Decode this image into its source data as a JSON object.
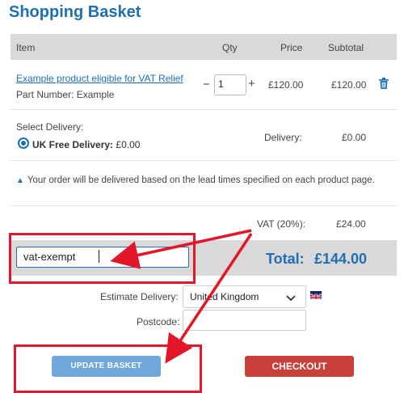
{
  "page": {
    "title": "Shopping Basket"
  },
  "table": {
    "headers": {
      "item": "Item",
      "qty": "Qty",
      "price": "Price",
      "subtotal": "Subtotal"
    }
  },
  "product": {
    "name": "Example product eligible for VAT Relief",
    "part_number": "Part Number: Example",
    "qty_minus": "−",
    "qty": "1",
    "qty_plus": "+",
    "price": "£120.00",
    "subtotal": "£120.00",
    "remove_icon": "trash-icon"
  },
  "delivery": {
    "select_label": "Select Delivery:",
    "option_label": "UK Free Delivery:",
    "option_price": "£0.00",
    "summary_label": "Delivery:",
    "summary_value": "£0.00"
  },
  "notice": {
    "icon": "triangle-up-icon",
    "text": "Your order will be delivered based on the lead times specified on each product page."
  },
  "vat": {
    "label": "VAT (20%):",
    "value": "£24.00"
  },
  "vat_input": {
    "value": "vat-exempt"
  },
  "total": {
    "label": "Total:",
    "value": "£144.00"
  },
  "estimate": {
    "label": "Estimate Delivery:",
    "country": "United Kingdom",
    "flag_icon": "uk-flag-icon",
    "postcode_label": "Postcode:",
    "postcode_value": ""
  },
  "buttons": {
    "update": "UPDATE BASKET",
    "checkout": "CHECKOUT"
  },
  "colors": {
    "accent": "#1f6fb5",
    "header_bg": "#d9d9d9",
    "update_button": "#6fa8dc",
    "checkout_button": "#c9403a",
    "annotation": "#e4162a"
  }
}
